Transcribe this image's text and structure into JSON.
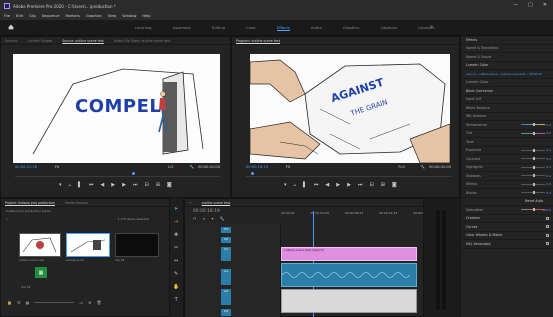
{
  "window": {
    "title": "Adobe Premiere Pro 2020 - C:\\Users\\...\\production *",
    "minimize": "—",
    "maximize": "□",
    "close": "✕"
  },
  "menu": [
    "File",
    "Edit",
    "Clip",
    "Sequence",
    "Markers",
    "Graphics",
    "View",
    "Window",
    "Help"
  ],
  "workspaces": {
    "tabs": [
      "Learning",
      "Assembly",
      "Editing",
      "Color",
      "Effects",
      "Audio",
      "Graphics",
      "Captions",
      "Libraries"
    ],
    "active_index": 4
  },
  "source_monitor": {
    "tabs": [
      "Sources",
      "Lumetri Scopes",
      "Source: outline scene test",
      "Audio Clip Mixer: outline scene test"
    ],
    "active_index": 2,
    "overlay_text": "COMPEL",
    "timecode_left": "00:00:21:18",
    "fit": "Fit",
    "ratio": "1/2",
    "timecode_right": "00:00:41:00"
  },
  "program_monitor": {
    "tab": "Program: outline scene test",
    "bag_text_line1": "AGAINST",
    "bag_text_line2": "THE GRAIN",
    "timecode_left": "00:00:18:19",
    "fit": "Fit",
    "ratio": "Full",
    "timecode_right": "00:00:41:00"
  },
  "project": {
    "tabs": [
      "Project: Indiana proj production",
      "Media Browser"
    ],
    "active_index": 0,
    "path": "Indiana proj production.prproj",
    "item_count": "1 of 8 items selected",
    "thumbs": [
      "outline scene test",
      "sequence 01",
      "clip 03",
      "clip 04"
    ]
  },
  "timeline": {
    "tab": "outline scene test",
    "timecode": "00:00:18:19",
    "ruler": [
      "00:00:00",
      "00:00:04:23",
      "00:00:09:23",
      "00:00:14:23",
      "00:00:19:23",
      "00:00:24:23"
    ],
    "tracks": [
      "V3",
      "V2",
      "V1",
      "A1",
      "A2",
      "A3"
    ],
    "clip_label": "outline scene test.mp4 [V]"
  },
  "effects": {
    "items": [
      {
        "label": "Effects",
        "type": "section"
      },
      {
        "label": "Speed & Transitions",
        "type": "row"
      },
      {
        "label": "Speed & Sound",
        "type": "row"
      },
      {
        "label": "Lumetri Color",
        "type": "section"
      },
      {
        "label": "Source • outline scene  ›  outline scene test • 00:00:00",
        "type": "blue"
      },
      {
        "label": "Lumetri Color",
        "type": "row"
      },
      {
        "label": "Basic Correction",
        "type": "section"
      },
      {
        "label": "Input LUT",
        "type": "row"
      },
      {
        "label": "White Balance",
        "type": "row"
      },
      {
        "label": "WB Selector",
        "type": "row"
      },
      {
        "label": "Temperature",
        "type": "slider",
        "value": "0.0"
      },
      {
        "label": "Tint",
        "type": "slider",
        "value": "0.0"
      },
      {
        "label": "Tone",
        "type": "row"
      },
      {
        "label": "Exposure",
        "type": "slider",
        "value": "0.0"
      },
      {
        "label": "Contrast",
        "type": "slider",
        "value": "0.0"
      },
      {
        "label": "Highlights",
        "type": "slider",
        "value": "0.0"
      },
      {
        "label": "Shadows",
        "type": "slider",
        "value": "0.0"
      },
      {
        "label": "Whites",
        "type": "slider",
        "value": "0.0"
      },
      {
        "label": "Blacks",
        "type": "slider",
        "value": "0.0"
      },
      {
        "label": "Reset    Auto",
        "type": "buttons"
      },
      {
        "label": "Saturation",
        "type": "slider",
        "value": "100.0"
      },
      {
        "label": "Creative",
        "type": "check"
      },
      {
        "label": "Curves",
        "type": "check"
      },
      {
        "label": "Color Wheels & Match",
        "type": "check"
      },
      {
        "label": "HSL Secondary",
        "type": "check"
      }
    ]
  },
  "colors": {
    "accent": "#4a9cff",
    "clip_video": "#e08ee0",
    "clip_audio": "#2a7ea8"
  }
}
